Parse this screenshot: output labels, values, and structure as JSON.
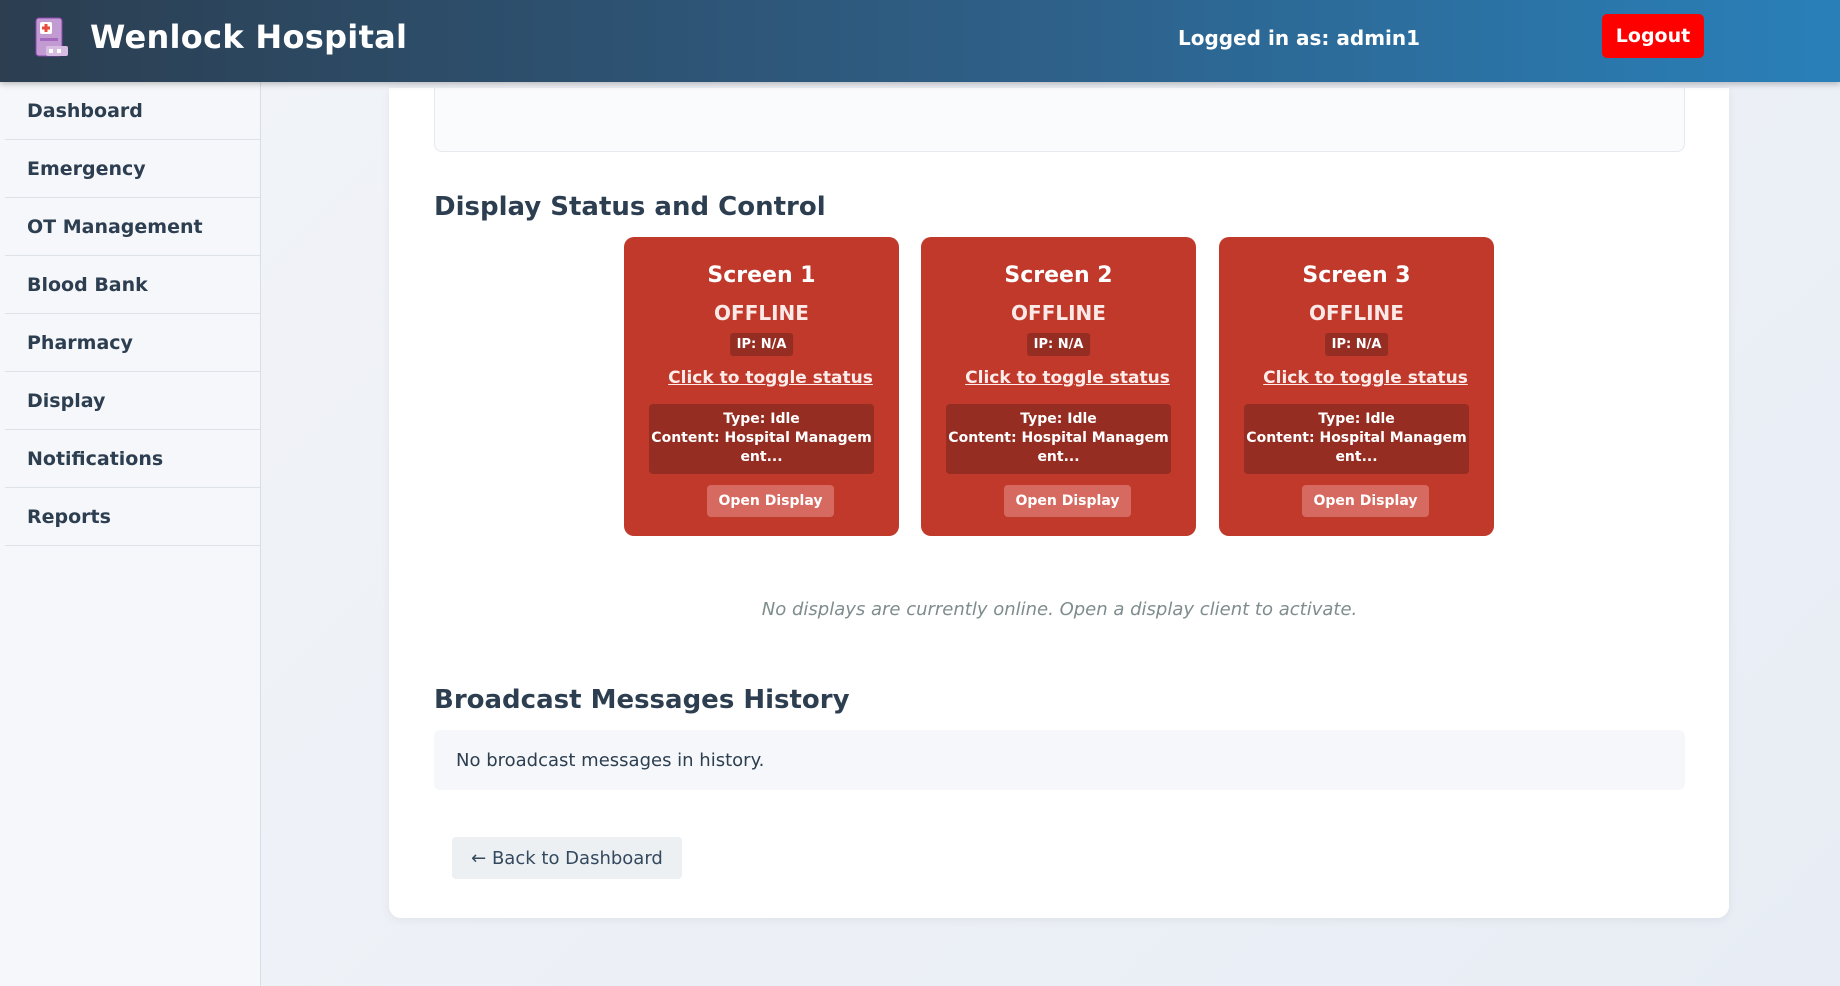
{
  "header": {
    "app_title": "Wenlock Hospital",
    "user_label": "Logged in as: admin1",
    "logout_label": "Logout"
  },
  "sidebar": {
    "items": [
      {
        "label": "Dashboard"
      },
      {
        "label": "Emergency"
      },
      {
        "label": "OT Management"
      },
      {
        "label": "Blood Bank"
      },
      {
        "label": "Pharmacy"
      },
      {
        "label": "Display"
      },
      {
        "label": "Notifications"
      },
      {
        "label": "Reports"
      }
    ]
  },
  "display_section": {
    "title": "Display Status and Control",
    "screens": [
      {
        "name": "Screen 1",
        "status": "OFFLINE",
        "ip": "IP: N/A",
        "toggle_label": "Click to toggle status",
        "type_line": "Type: Idle",
        "content_line": "Content: Hospital Managem",
        "content_cont": "ent...",
        "open_label": "Open Display"
      },
      {
        "name": "Screen 2",
        "status": "OFFLINE",
        "ip": "IP: N/A",
        "toggle_label": "Click to toggle status",
        "type_line": "Type: Idle",
        "content_line": "Content: Hospital Managem",
        "content_cont": "ent...",
        "open_label": "Open Display"
      },
      {
        "name": "Screen 3",
        "status": "OFFLINE",
        "ip": "IP: N/A",
        "toggle_label": "Click to toggle status",
        "type_line": "Type: Idle",
        "content_line": "Content: Hospital Managem",
        "content_cont": "ent...",
        "open_label": "Open Display"
      }
    ],
    "offline_note": "No displays are currently online. Open a display client to activate."
  },
  "broadcast_section": {
    "title": "Broadcast Messages History",
    "empty_text": "No broadcast messages in history."
  },
  "back_button_label": "← Back to Dashboard",
  "colors": {
    "offline_card": "#c0392b",
    "logout": "#ff0000",
    "header_start": "#2c3e50",
    "header_end": "#2980b9"
  },
  "icons": {
    "logo": "hospital-building-icon"
  }
}
